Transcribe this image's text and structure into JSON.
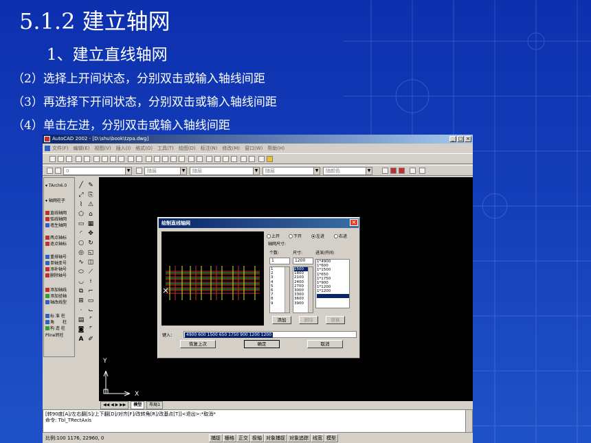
{
  "slide": {
    "title": "5.1.2 建立轴网",
    "subtitle": "1、建立直线轴网",
    "steps": [
      "（2）选择上开间状态，分别双击或输入轴线间距",
      "（3）再选择下开间状态，分别双击或输入轴线间距",
      "（4）单击左进，分别双击或输入轴线间距"
    ]
  },
  "cad": {
    "title": "AutoCAD 2002 - [D:\\shu\\book\\tzpa.dwg]",
    "menu": [
      "文件(F)",
      "编辑(E)",
      "视图(V)",
      "插入(I)",
      "格式(O)",
      "工具(T)",
      "绘图(D)",
      "标注(N)",
      "修改(M)",
      "窗口(W)",
      "帮助(H)"
    ],
    "layer_combo": "0",
    "color_combo": "ByLayer",
    "color_short": "随层",
    "linetype_combo": "随层",
    "lineweight_combo": "随层",
    "plotstyle_combo": "随颜色",
    "palette": {
      "title": "TArch6.0",
      "groups": [
        "轴网柱子"
      ],
      "items": [
        "直线轴网",
        "弧线轴网",
        "墙生轴网",
        "两点轴标",
        "逐点轴标",
        "重排轴号",
        "单轴变号",
        "添补轴号",
        "删除轴号",
        "添加轴线",
        "添加径轴",
        "轴改线型",
        "标 准 柱",
        "角　　柱",
        "构 造 柱",
        "Pline转柱"
      ]
    },
    "layout_tabs": [
      "模型",
      "布局1"
    ],
    "command_lines": [
      "[转90度[A]/左右翻[S]/上下翻[D]/对齐[F]/改转角[R]/改基点[T]]<退出>:*取消*",
      "命令: Tbl_TRectAxis"
    ],
    "coords": "比例:100 1176, 22960, 0",
    "modes": [
      "捕捉",
      "栅格",
      "正交",
      "极轴",
      "对象捕捉",
      "对象追踪",
      "线宽",
      "模型"
    ],
    "ucs_x": "X",
    "ucs_y": "Y"
  },
  "dialog": {
    "title": "绘制直线轴网",
    "radios": [
      "上开",
      "下开",
      "左进",
      "右进"
    ],
    "selected_radio": "左进",
    "group_label": "轴网尺寸:",
    "count_label": "个数:",
    "size_label": "尺寸:",
    "depth_label": "进深/开间:",
    "count_value": "1",
    "size_value": "1200",
    "count_list": [
      "1",
      "2",
      "3",
      "4",
      "5",
      "6",
      "7",
      "8",
      "9"
    ],
    "size_list": [
      "1500",
      "1800",
      "2100",
      "2400",
      "2700",
      "3000",
      "3300",
      "3600",
      "3900"
    ],
    "depth_list": [
      "1*4900",
      "1*600",
      "1*1500",
      "1*650",
      "1*1750",
      "1*900",
      "1*1200",
      "1*1200"
    ],
    "buttons": {
      "add": "添加",
      "delete": "删除",
      "replace": "替换",
      "restore": "恢复上次",
      "ok": "确定",
      "cancel": "取消"
    },
    "input_label": "键入：",
    "input_value": "4900 600 1500 650 1750 900 1200 1200"
  }
}
